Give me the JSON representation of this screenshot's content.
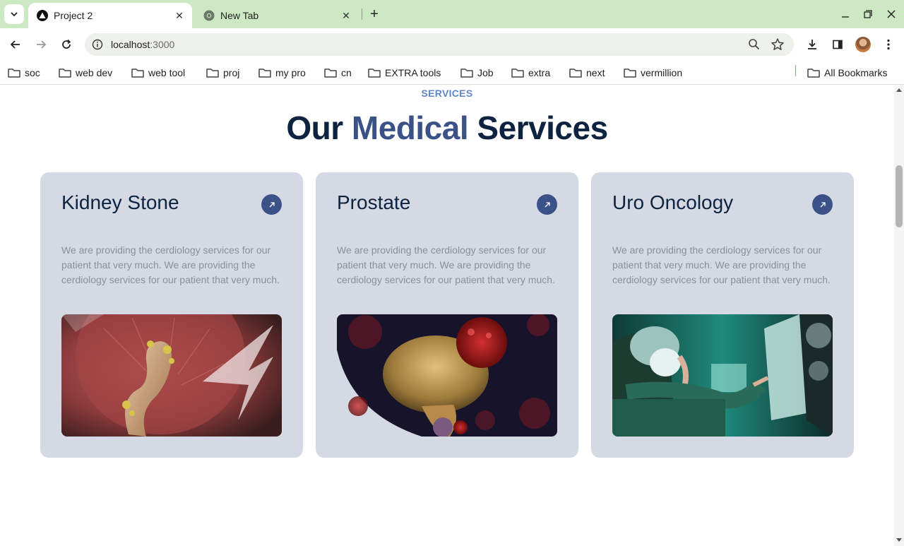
{
  "browser": {
    "tabs": [
      {
        "title": "Project 2",
        "active": true
      },
      {
        "title": "New Tab",
        "active": false
      }
    ],
    "url": {
      "host": "localhost",
      "port": ":3000"
    },
    "bookmarks": [
      "soc",
      "web dev",
      "web tool",
      "proj",
      "my pro",
      "cn",
      "EXTRA tools",
      "Job",
      "extra",
      "next",
      "vermillion"
    ],
    "all_bookmarks": "All Bookmarks"
  },
  "section": {
    "eyebrow": "SERVICES",
    "heading": {
      "part1": "Our ",
      "accent": "Medical",
      "part2": " Services"
    }
  },
  "cards": [
    {
      "title": "Kidney Stone",
      "description": "We are providing the cerdiology services for our patient that very much. We are providing the cerdiology services for our patient that very much."
    },
    {
      "title": "Prostate",
      "description": "We are providing the cerdiology services for our patient that very much. We are providing the cerdiology services for our patient that very much."
    },
    {
      "title": "Uro Oncology",
      "description": "We are providing the cerdiology services for our patient that very much. We are providing the cerdiology services for our patient that very much."
    }
  ],
  "colors": {
    "tabstrip": "#cde9c3",
    "accent": "#3a5288",
    "card": "#d5d9e3",
    "heading": "#0d2340",
    "eyebrow": "#5e86c8"
  }
}
